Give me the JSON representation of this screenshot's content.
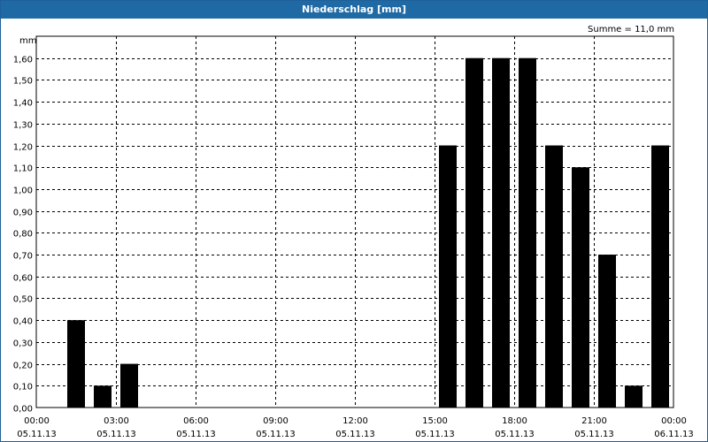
{
  "window": {
    "title": "Niederschlag [mm]"
  },
  "chart_data": {
    "type": "bar",
    "title": "Niederschlag [mm]",
    "ylabel": "mm",
    "summary": "Summe = 11,0 mm",
    "ylim": [
      0,
      1.7
    ],
    "yticks": [
      "0,00",
      "0,10",
      "0,20",
      "0,30",
      "0,40",
      "0,50",
      "0,60",
      "0,70",
      "0,80",
      "0,90",
      "1,00",
      "1,10",
      "1,20",
      "1,30",
      "1,40",
      "1,50",
      "1,60"
    ],
    "xlim_hours": [
      0,
      24
    ],
    "xticks": [
      {
        "time": "00:00",
        "date": "05.11.13"
      },
      {
        "time": "03:00",
        "date": "05.11.13"
      },
      {
        "time": "06:00",
        "date": "05.11.13"
      },
      {
        "time": "09:00",
        "date": "05.11.13"
      },
      {
        "time": "12:00",
        "date": "05.11.13"
      },
      {
        "time": "15:00",
        "date": "05.11.13"
      },
      {
        "time": "18:00",
        "date": "05.11.13"
      },
      {
        "time": "21:00",
        "date": "05.11.13"
      },
      {
        "time": "00:00",
        "date": "06.11.13"
      }
    ],
    "hours": [
      0.5,
      1.5,
      2.5,
      3.5,
      4.5,
      5.5,
      6.5,
      7.5,
      8.5,
      9.5,
      10.5,
      11.5,
      12.5,
      13.5,
      14.5,
      15.5,
      16.5,
      17.5,
      18.5,
      19.5,
      20.5,
      21.5,
      22.5,
      23.5
    ],
    "values": [
      0,
      0.4,
      0.1,
      0.2,
      0,
      0,
      0,
      0,
      0,
      0,
      0,
      0,
      0,
      0,
      0,
      1.2,
      1.6,
      1.6,
      1.6,
      1.2,
      1.1,
      0.7,
      0.1,
      1.2
    ],
    "grid": true,
    "bar_color": "#000000"
  }
}
